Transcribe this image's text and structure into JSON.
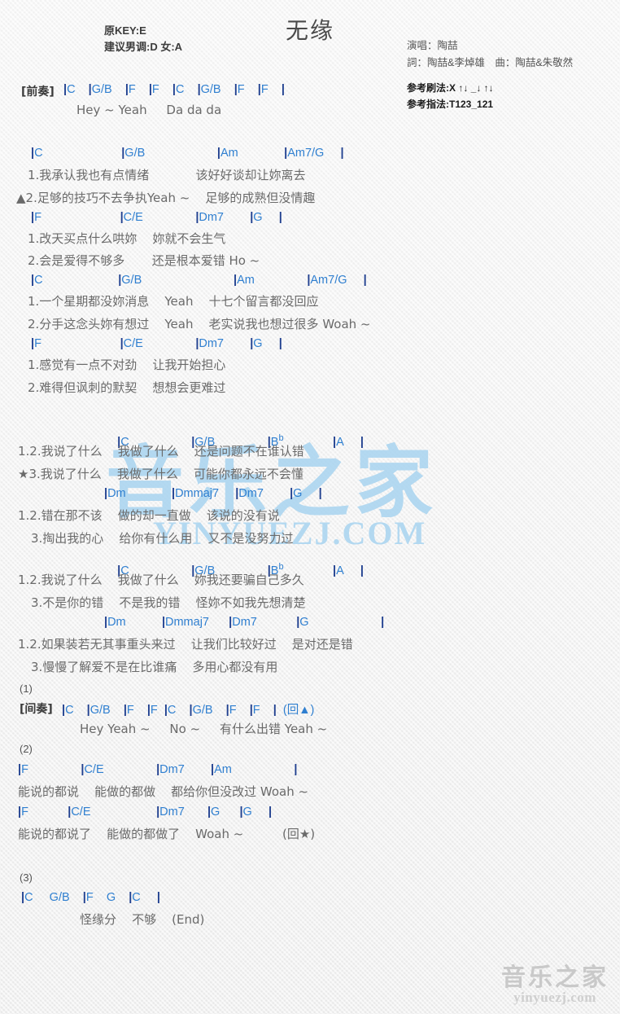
{
  "meta": {
    "title": "无缘",
    "original_key": "原KEY:E",
    "suggested_key": "建议男调:D 女:A",
    "singer": "演唱：陶喆",
    "writers": "詞：陶喆&李焯雄　曲：陶喆&朱敬然",
    "strum_pattern": "参考刷法:X ↑↓ _↓ ↑↓",
    "finger_pattern": "参考指法:T123_121"
  },
  "watermark": {
    "center_cn": "音乐之家",
    "center_en": "YINYUEZJ.COM",
    "corner_cn": "音乐之家",
    "corner_en": "yinyuezj.com"
  },
  "colors": {
    "chord": "#2f7fd0",
    "bar": "#1f3f8f",
    "lyric": "#6a6a6a",
    "watermark_center": "#a8d4f0",
    "watermark_corner": "#c9c9c9",
    "background": "#f2f2f2"
  },
  "sections": {
    "intro_label": "[前奏]",
    "intro_chords": "|C    |G/B    |F    |F    |C    |G/B    |F    |F    |",
    "intro_lyric": "Hey ~ Yeah     Da da da",
    "v1_c1": "|C                        |G/B                      |Am              |Am7/G     |",
    "v1_l1": "1.我承认我也有点情绪            该好好谈却让妳离去",
    "v1_l2": "▲2.足够的技巧不去争执Yeah ~    足够的成熟但没情趣",
    "v1_c2": "|F                        |C/E                |Dm7        |G     |",
    "v1_l3": "1.改天买点什么哄妳    妳就不会生气",
    "v1_l4": "2.会是爱得不够多       还是根本爱错 Ho ~",
    "v2_c1": "|C                       |G/B                            |Am                |Am7/G     |",
    "v2_l1": "1.一个星期都没妳消息    Yeah    十七个留言都没回应",
    "v2_l2": "2.分手这念头妳有想过    Yeah    老实说我也想过很多 Woah ~",
    "v2_c2": "|F                        |C/E                |Dm7        |G     |",
    "v2_l3": "1.感觉有一点不对劲    让我开始担心",
    "v2_l4": "2.难得但讽刺的默契    想想会更难过",
    "ch1_c1": "|C                        |G/B                      |B♭                |A     |",
    "ch1_l1": "1.2.我说了什么    我做了什么    还是问题不在谁认错",
    "ch1_l2": "★3.我说了什么    我做了什么    可能你都永远不会懂",
    "ch1_c2": "|Dm              |Dmmaj7     |Dm7        |G     |",
    "ch1_l3": "1.2.错在那不该    做的却一直做    该说的没有说",
    "ch1_l4": "3.掏出我的心    给你有什么用    又不是没努力过",
    "ch2_c1": "|C                        |G/B                      |B♭                |A     |",
    "ch2_l1": "1.2.我说了什么    我做了什么    妳我还要骗自己多久",
    "ch2_l2": "3.不是你的错    不是我的错    怪妳不如我先想清楚",
    "ch2_c2": "|Dm           |Dmmaj7      |Dm7            |G                      |",
    "ch2_l3": "1.2.如果装若无其事重头来过    让我们比较好过    是对还是错",
    "ch2_l4": "3.慢慢了解爱不是在比谁痛    多用心都没有用",
    "mark1": "(1)",
    "interlude_label": "[间奏]",
    "interlude_chords": "|C    |G/B    |F    |F  |C    |G/B    |F    |F    |  (回▲)",
    "interlude_lyric": "Hey Yeah ~     No ~     有什么出错 Yeah ~",
    "mark2": "(2)",
    "br_c1": "|F                |C/E                |Dm7        |Am                   |",
    "br_l1": "能说的都说    能做的都做    都给你但没改过 Woah ~",
    "br_c2": "|F            |C/E                    |Dm7       |G      |G     |",
    "br_l2": "能说的都说了    能做的都做了    Woah ~          (回★)",
    "mark3": "(3)",
    "end_chords": "|C     G/B    |F    G    |C     |",
    "end_lyric": "怪缘分    不够    (End)"
  }
}
